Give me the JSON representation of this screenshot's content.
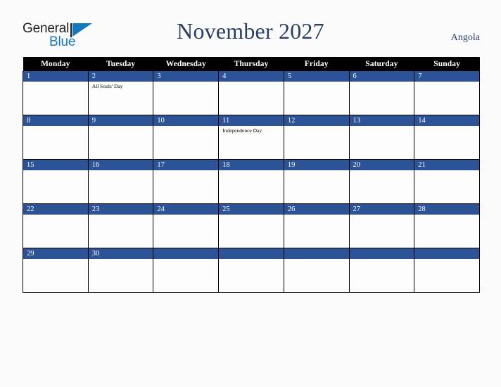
{
  "brand": {
    "name_part1": "General",
    "name_part2": "Blue",
    "triangle_color": "#1278BE",
    "text_color": "#231F20"
  },
  "header": {
    "title": "November 2027",
    "country": "Angola",
    "title_color": "#2A3F66"
  },
  "theme": {
    "header_row_bg": "#000000",
    "header_row_text": "#FFFFFF",
    "day_bar_bg": "#2C5395",
    "day_bar_text": "#FFFFFF",
    "cell_bg": "#FDFDFD",
    "grid_line": "#000000",
    "page_bg": "#FCFBFC"
  },
  "weekdays": [
    "Monday",
    "Tuesday",
    "Wednesday",
    "Thursday",
    "Friday",
    "Saturday",
    "Sunday"
  ],
  "weeks": [
    [
      {
        "day": "1",
        "events": []
      },
      {
        "day": "2",
        "events": [
          "All Souls' Day"
        ]
      },
      {
        "day": "3",
        "events": []
      },
      {
        "day": "4",
        "events": []
      },
      {
        "day": "5",
        "events": []
      },
      {
        "day": "6",
        "events": []
      },
      {
        "day": "7",
        "events": []
      }
    ],
    [
      {
        "day": "8",
        "events": []
      },
      {
        "day": "9",
        "events": []
      },
      {
        "day": "10",
        "events": []
      },
      {
        "day": "11",
        "events": [
          "Independence Day"
        ]
      },
      {
        "day": "12",
        "events": []
      },
      {
        "day": "13",
        "events": []
      },
      {
        "day": "14",
        "events": []
      }
    ],
    [
      {
        "day": "15",
        "events": []
      },
      {
        "day": "16",
        "events": []
      },
      {
        "day": "17",
        "events": []
      },
      {
        "day": "18",
        "events": []
      },
      {
        "day": "19",
        "events": []
      },
      {
        "day": "20",
        "events": []
      },
      {
        "day": "21",
        "events": []
      }
    ],
    [
      {
        "day": "22",
        "events": []
      },
      {
        "day": "23",
        "events": []
      },
      {
        "day": "24",
        "events": []
      },
      {
        "day": "25",
        "events": []
      },
      {
        "day": "26",
        "events": []
      },
      {
        "day": "27",
        "events": []
      },
      {
        "day": "28",
        "events": []
      }
    ],
    [
      {
        "day": "29",
        "events": []
      },
      {
        "day": "30",
        "events": []
      },
      {
        "day": "",
        "events": []
      },
      {
        "day": "",
        "events": []
      },
      {
        "day": "",
        "events": []
      },
      {
        "day": "",
        "events": []
      },
      {
        "day": "",
        "events": []
      }
    ]
  ]
}
